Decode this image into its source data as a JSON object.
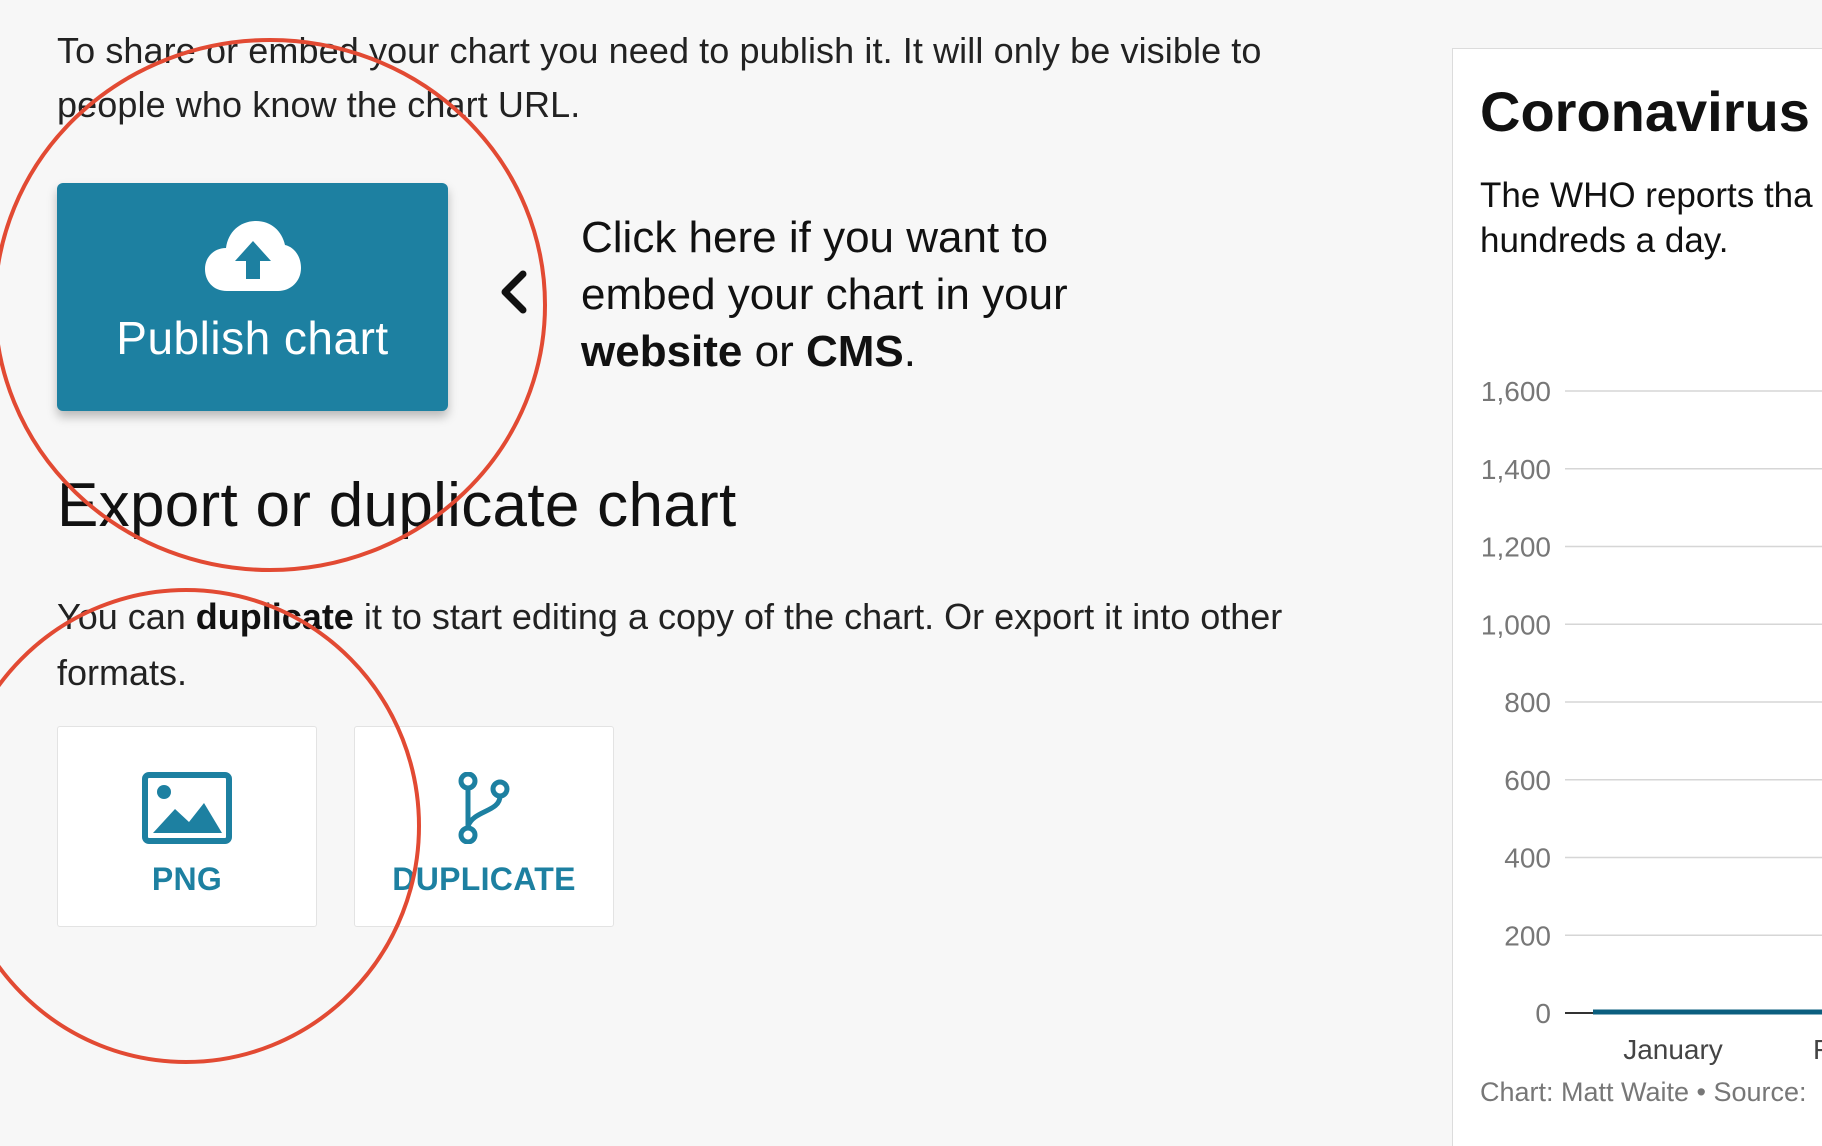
{
  "intro": {
    "text_line1": "To share or embed your chart you need to publish it. It will only be visible to",
    "text_line2": "people who know the chart URL."
  },
  "publish": {
    "button_label": "Publish chart",
    "icon": "cloud-upload-icon"
  },
  "callout": {
    "line1": "Click here if you want to",
    "line2": "embed your chart in your",
    "bold1": "website",
    "mid": " or ",
    "bold2": "CMS",
    "end": ".",
    "icon": "chevron-left-icon"
  },
  "export": {
    "title": "Export or duplicate chart",
    "text_before": "You can ",
    "text_bold": "duplicate",
    "text_after": " it to start editing a copy of the chart. Or export it into other",
    "text_line2": "formats.",
    "tiles": [
      {
        "label": "PNG",
        "icon": "image-icon"
      },
      {
        "label": "DUPLICATE",
        "icon": "fork-icon"
      }
    ]
  },
  "preview": {
    "title": "Coronavirus c",
    "desc_line1": "The WHO reports tha",
    "desc_line2": "hundreds a day.",
    "footer": "Chart: Matt Waite • Source:"
  },
  "chart_data": {
    "type": "line",
    "y_ticks": [
      "1,600",
      "1,400",
      "1,200",
      "1,000",
      "800",
      "600",
      "400",
      "200",
      "0"
    ],
    "x_ticks": [
      "January",
      "Fe"
    ],
    "ylim": [
      0,
      1600
    ],
    "grid": true,
    "series": [
      {
        "values": [
          0,
          0,
          0,
          0,
          0,
          0
        ]
      }
    ]
  },
  "colors": {
    "accent": "#1d80a1",
    "annotation": "#e24a33",
    "series": "#0b5f7f"
  }
}
